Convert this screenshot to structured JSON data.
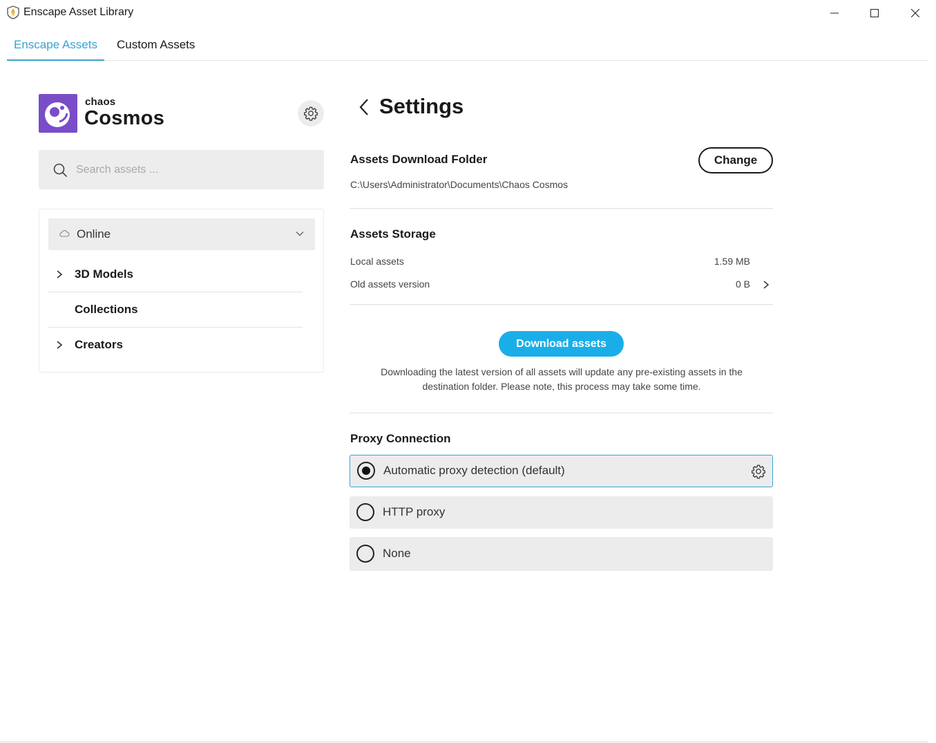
{
  "window": {
    "title": "Enscape Asset Library"
  },
  "tabs": [
    {
      "label": "Enscape Assets",
      "active": true
    },
    {
      "label": "Custom Assets",
      "active": false
    }
  ],
  "sidebar": {
    "brand_small": "chaos",
    "brand_large": "Cosmos",
    "search_placeholder": "Search assets ...",
    "source_selected": "Online",
    "nav_items": [
      {
        "label": "3D Models",
        "expandable": true
      },
      {
        "label": "Collections",
        "expandable": false
      },
      {
        "label": "Creators",
        "expandable": true
      }
    ]
  },
  "settings": {
    "title": "Settings",
    "download_folder": {
      "heading": "Assets Download Folder",
      "change_label": "Change",
      "path": "C:\\Users\\Administrator\\Documents\\Chaos Cosmos"
    },
    "storage": {
      "heading": "Assets Storage",
      "local_label": "Local assets",
      "local_value": "1.59 MB",
      "old_label": "Old assets version",
      "old_value": "0 B"
    },
    "download": {
      "button_label": "Download assets",
      "note": "Downloading the latest version of all assets will update any pre-existing assets in the destination folder. Please note, this process may take some time."
    },
    "proxy": {
      "heading": "Proxy Connection",
      "options": [
        {
          "label": "Automatic proxy detection (default)",
          "selected": true
        },
        {
          "label": "HTTP proxy",
          "selected": false
        },
        {
          "label": "None",
          "selected": false
        }
      ]
    }
  },
  "colors": {
    "accent": "#3aa3cf",
    "download_button": "#1aaee8",
    "brand_purple": "#7a4dc8"
  }
}
